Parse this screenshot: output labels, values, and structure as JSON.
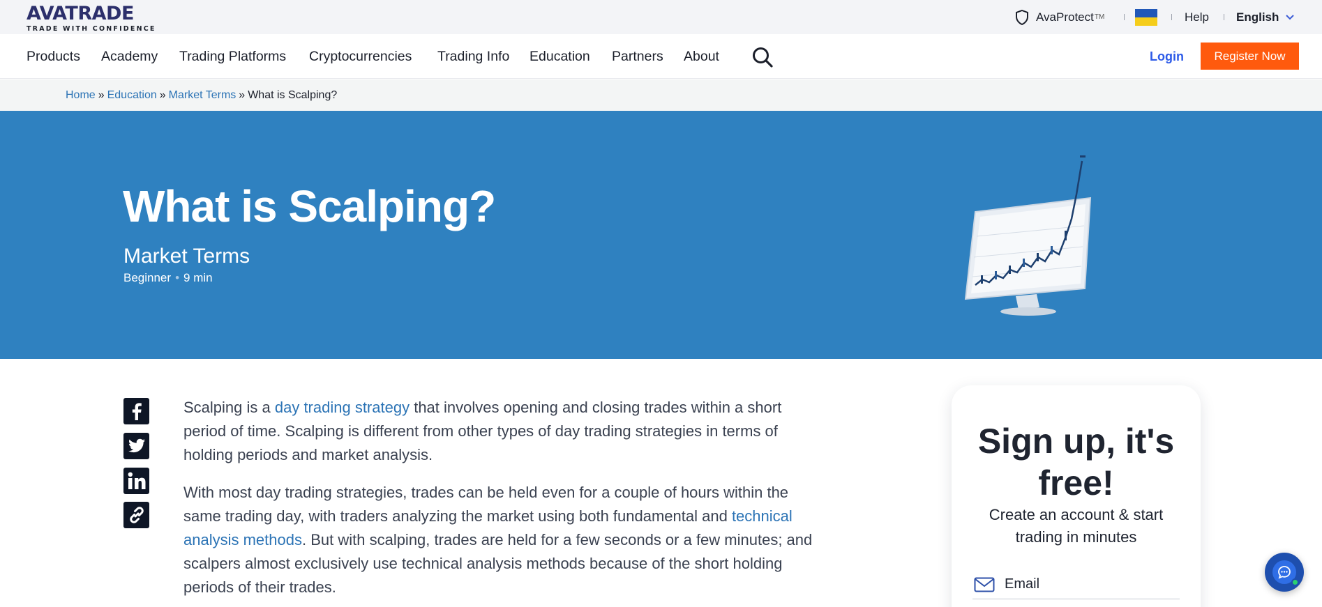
{
  "brand": {
    "logo_text": "AVATRADE",
    "tagline": "TRADE WITH CONFIDENCE",
    "accent_color": "#2f81c0",
    "cta_color": "#ff5a0d"
  },
  "utility_bar": {
    "avaprotect": "AvaProtect",
    "avaprotect_tm": "TM",
    "help": "Help",
    "language": "English"
  },
  "nav": {
    "items": [
      "Products",
      "Academy",
      "Trading Platforms",
      "Cryptocurrencies",
      "Trading Info",
      "Education",
      "Partners",
      "About"
    ],
    "login": "Login",
    "register": "Register Now"
  },
  "breadcrumb": {
    "home": "Home",
    "sep": "»",
    "education": "Education",
    "market_terms": "Market Terms",
    "current": "What is Scalping?"
  },
  "hero": {
    "title": "What is Scalping?",
    "category": "Market Terms",
    "level": "Beginner",
    "dot": "•",
    "read_time": "9 min"
  },
  "share": [
    "facebook-icon",
    "twitter-icon",
    "linkedin-icon",
    "link-icon"
  ],
  "article": {
    "p1_a": "Scalping is a ",
    "p1_link": "day trading strategy",
    "p1_b": " that involves opening and closing trades within a short period of time. Scalping is different from other types of day trading strategies in terms of holding periods and market analysis.",
    "p2_a": "With most day trading strategies, trades can be held even for a couple of hours within the same trading day, with traders analyzing the market using both fundamental and ",
    "p2_link": "technical analysis methods",
    "p2_b": ". But with scalping, trades are held for a few seconds or a few minutes; and scalpers almost exclusively use technical analysis methods because of the short holding periods of their trades."
  },
  "signup": {
    "title": "Sign up, it's free!",
    "subtitle": "Create an account & start trading in minutes",
    "email_placeholder": "Email"
  }
}
